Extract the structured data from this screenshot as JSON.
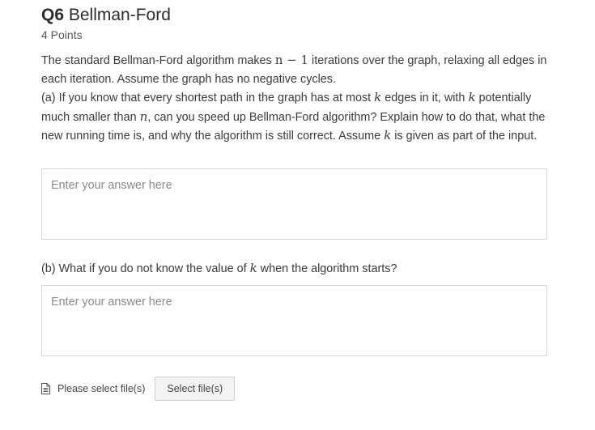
{
  "question": {
    "number": "Q6",
    "title": "Bellman-Ford",
    "points": "4 Points"
  },
  "prompt": {
    "p1_a": "The standard Bellman-Ford algorithm makes ",
    "p1_math": "n − 1",
    "p1_b": " iterations over the graph, relaxing all edges in each iteration.  Assume the graph has no negative cycles.",
    "pa_a": "(a) If you know that every shortest path in the graph has at most ",
    "pa_k1": "k",
    "pa_b": " edges in it, with ",
    "pa_k2": "k",
    "pa_c": " potentially much smaller than ",
    "pa_n": "n",
    "pa_d": ", can you speed up Bellman-Ford algorithm?  Explain how to do that, what the new running time is, and why the algorithm is still correct.  Assume ",
    "pa_k3": "k",
    "pa_e": " is given as part of the input."
  },
  "answer_a": {
    "placeholder": "Enter your answer here",
    "value": ""
  },
  "part_b": {
    "text_a": "(b) What if you do not know the value of ",
    "k": "k",
    "text_b": " when the algorithm starts?"
  },
  "answer_b": {
    "placeholder": "Enter your answer here",
    "value": ""
  },
  "file": {
    "icon": "document-icon",
    "label": "Please select file(s)",
    "button_label": "Select file(s)"
  }
}
